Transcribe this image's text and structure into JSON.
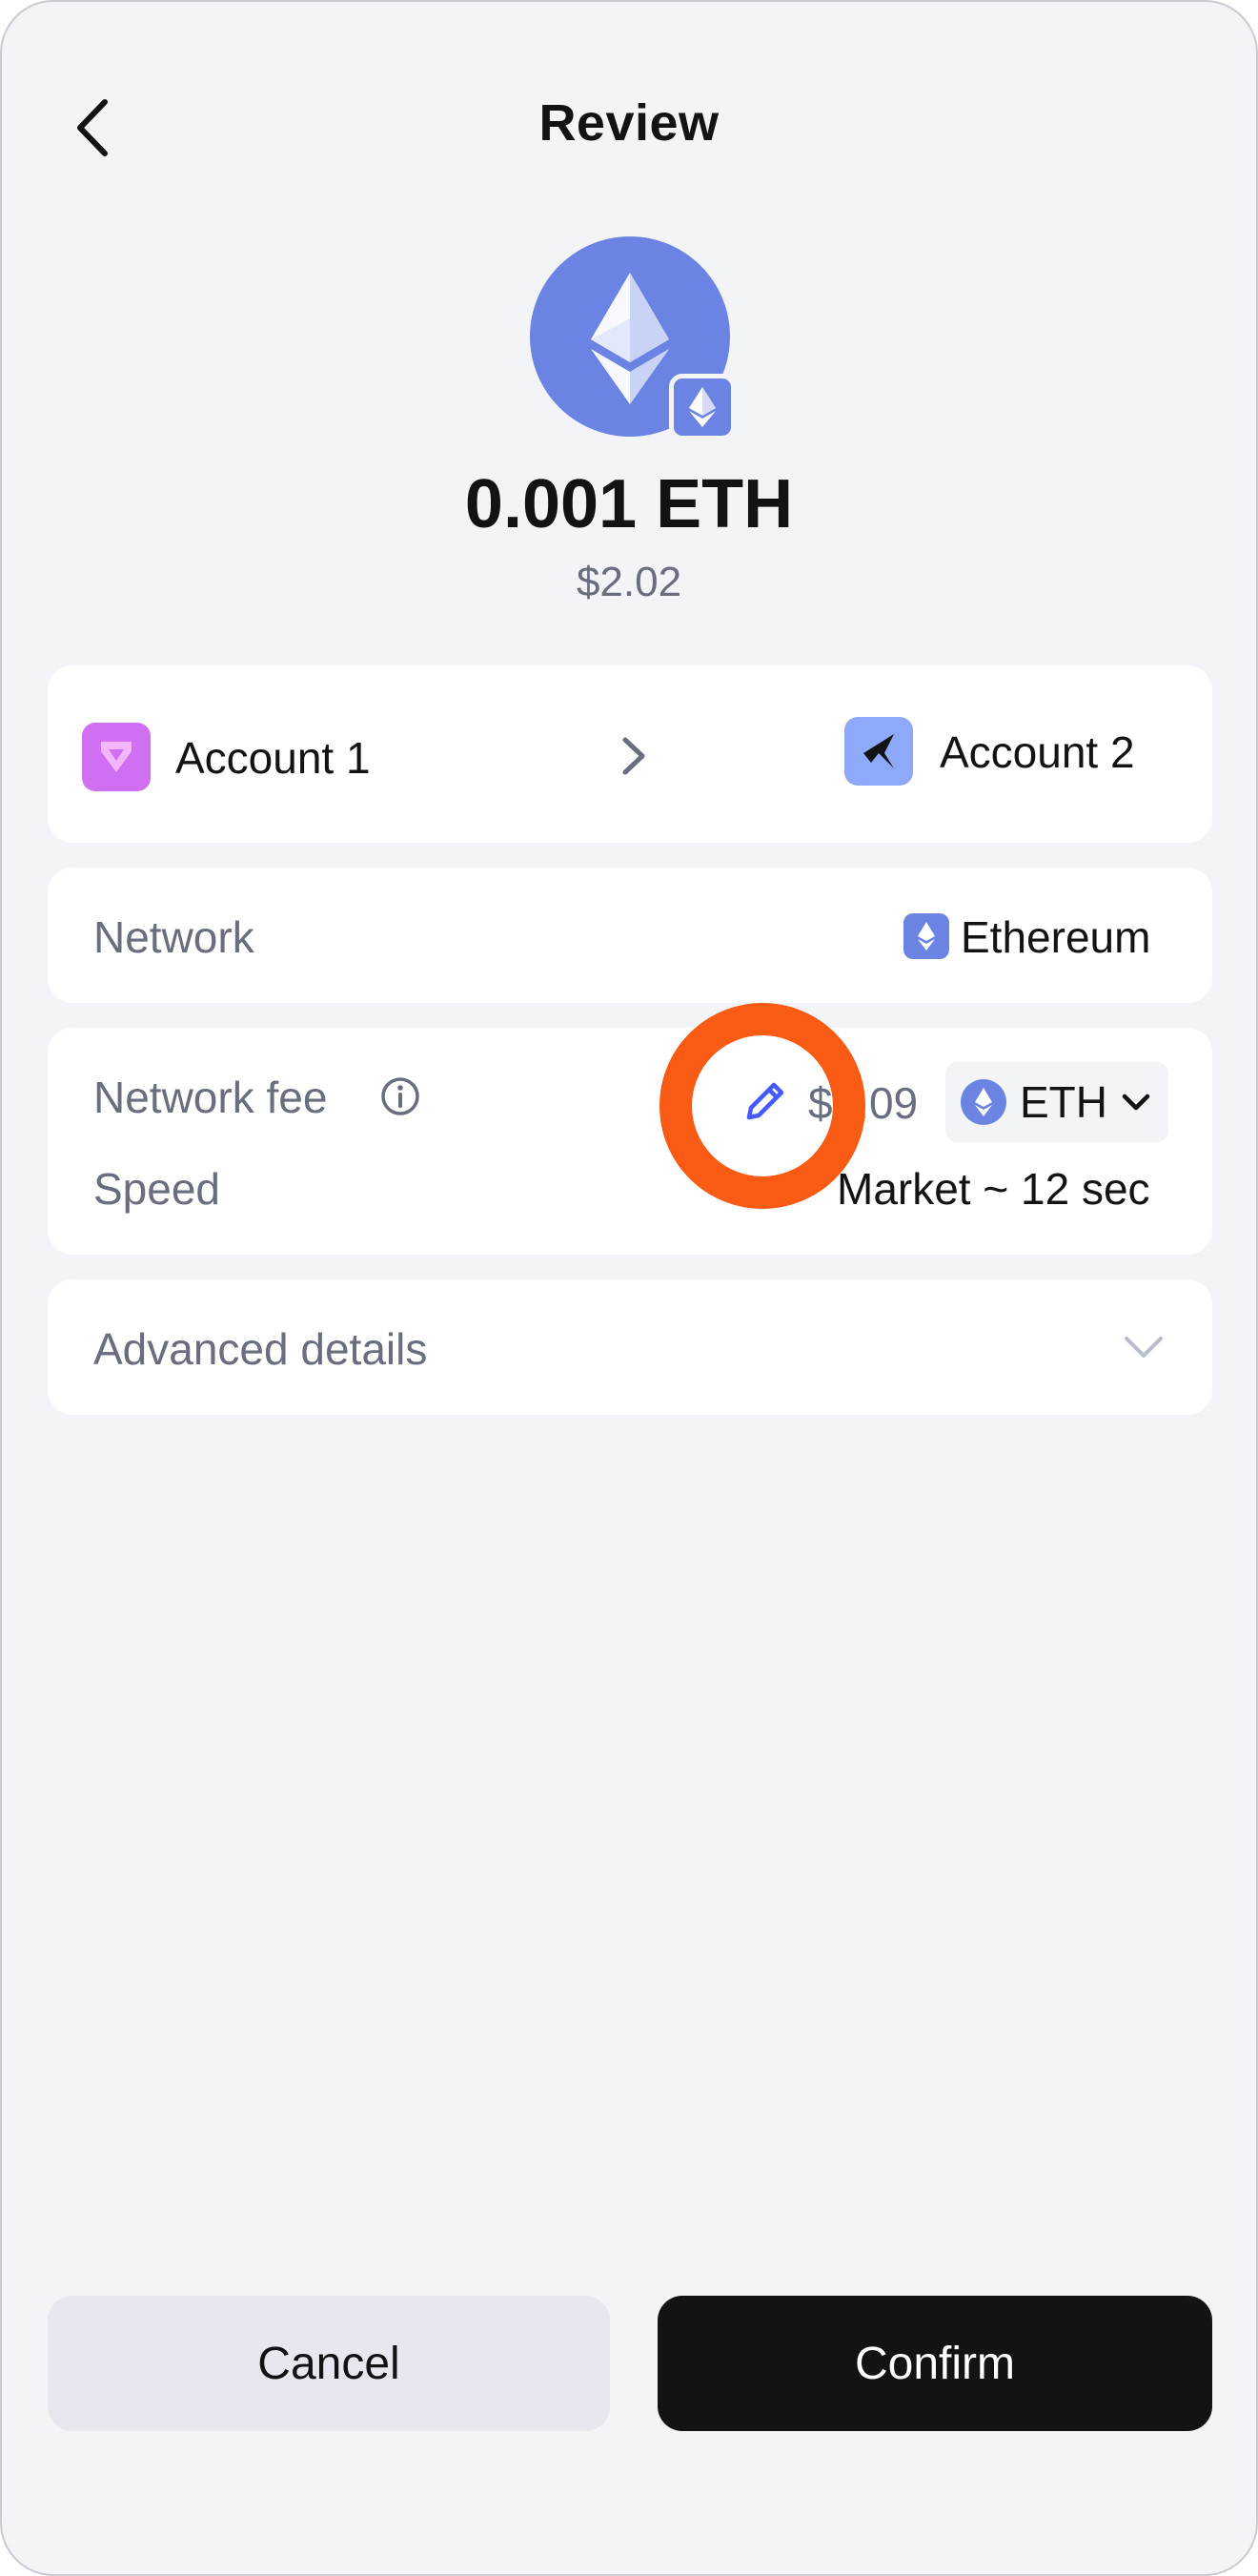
{
  "header": {
    "title": "Review"
  },
  "token": {
    "amount": "0.001 ETH",
    "fiat_value": "$2.02",
    "icon": "ethereum-icon",
    "color": "#6b84e3"
  },
  "transfer": {
    "from_account": "Account 1",
    "to_account": "Account 2",
    "from_avatar_color": "#d16ff2",
    "to_avatar_color": "#8ea9f7"
  },
  "network": {
    "label": "Network",
    "value": "Ethereum"
  },
  "fee": {
    "label": "Network fee",
    "amount": "$0.09",
    "token": "ETH",
    "speed_label": "Speed",
    "speed_value": "Market ~ 12 sec"
  },
  "advanced": {
    "label": "Advanced details"
  },
  "actions": {
    "cancel_label": "Cancel",
    "confirm_label": "Confirm"
  },
  "colors": {
    "background": "#f3f4f8",
    "card": "#ffffff",
    "accent": "#4459ff",
    "highlight": "#fa5b14"
  }
}
